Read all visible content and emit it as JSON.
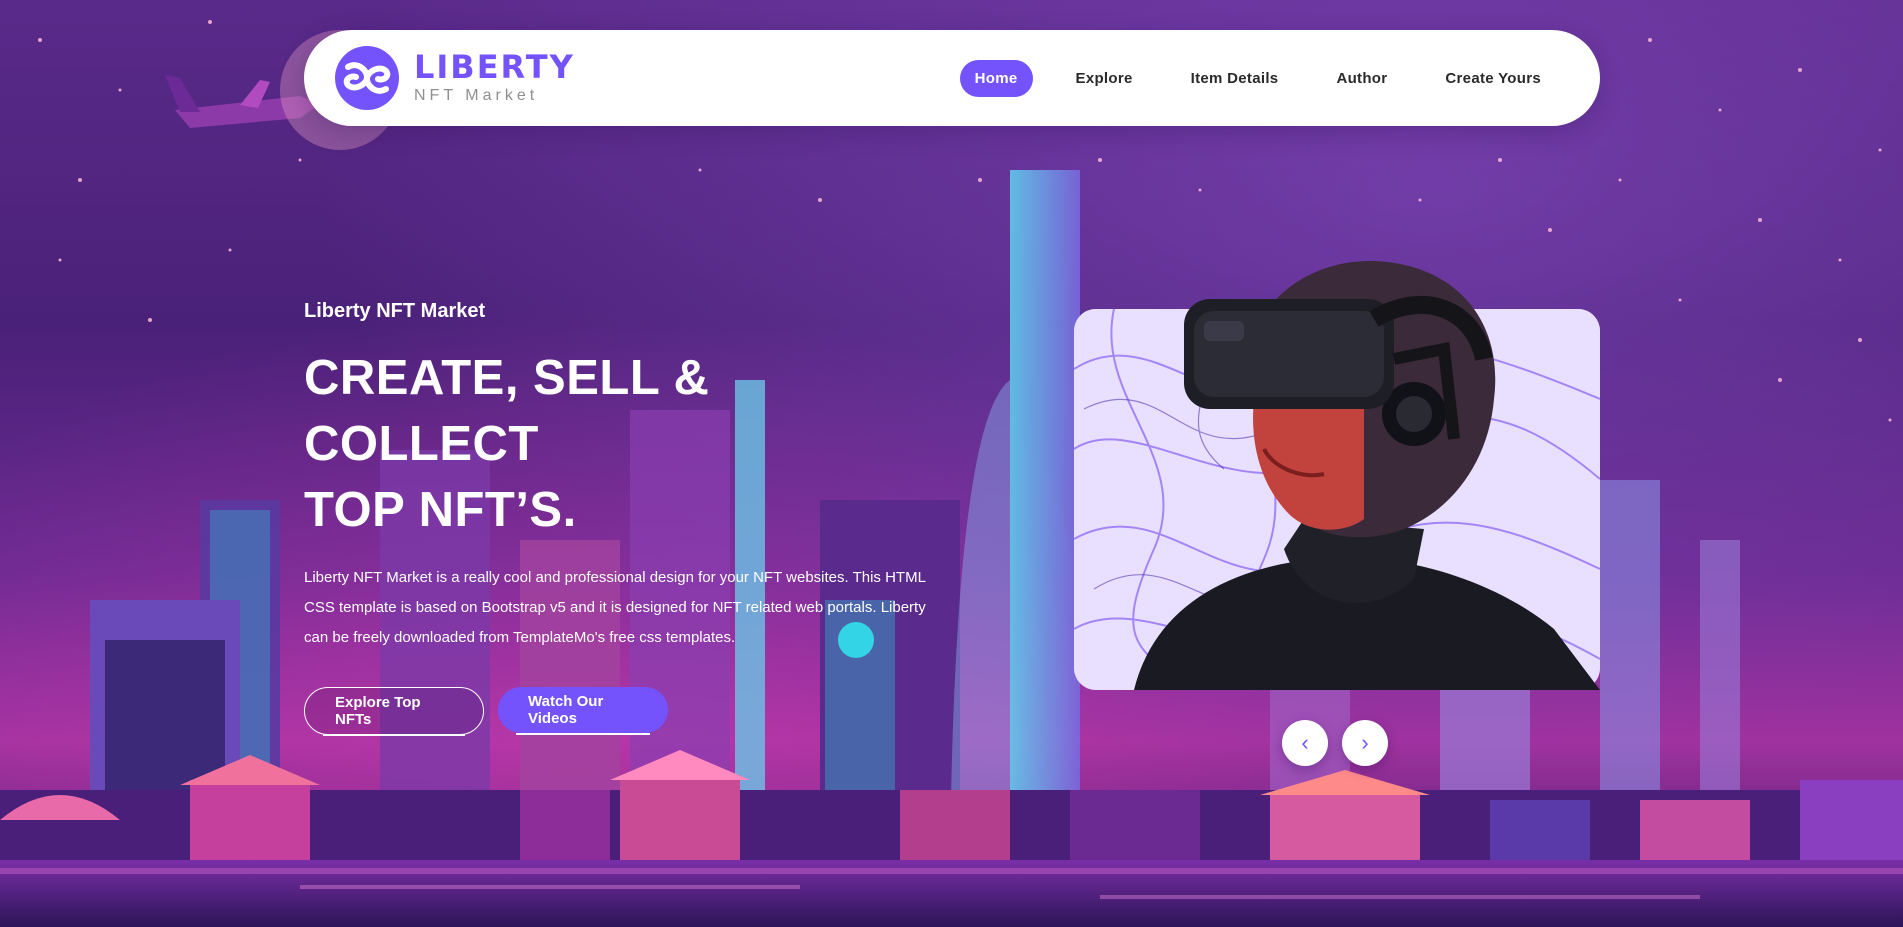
{
  "brand": {
    "name": "LIBERTY",
    "subtitle": "NFT Market",
    "color": "#7453fc"
  },
  "nav": {
    "items": [
      {
        "label": "Home",
        "active": true
      },
      {
        "label": "Explore",
        "active": false
      },
      {
        "label": "Item Details",
        "active": false
      },
      {
        "label": "Author",
        "active": false
      },
      {
        "label": "Create Yours",
        "active": false
      }
    ]
  },
  "hero": {
    "eyebrow": "Liberty NFT Market",
    "headline_line1": "CREATE, SELL & COLLECT",
    "headline_line2": "TOP NFT’S.",
    "description": "Liberty NFT Market is a really cool and professional design for your NFT websites. This HTML CSS template is based on Bootstrap v5 and it is designed for NFT related web portals. Liberty can be freely downloaded from TemplateMo's free css templates.",
    "buttons": {
      "explore": "Explore Top NFTs",
      "watch": "Watch Our Videos"
    }
  },
  "slider": {
    "prev": "‹",
    "next": "›"
  },
  "icons": {
    "logo": "liberty-logo-icon",
    "prev": "chevron-left-icon",
    "next": "chevron-right-icon"
  }
}
